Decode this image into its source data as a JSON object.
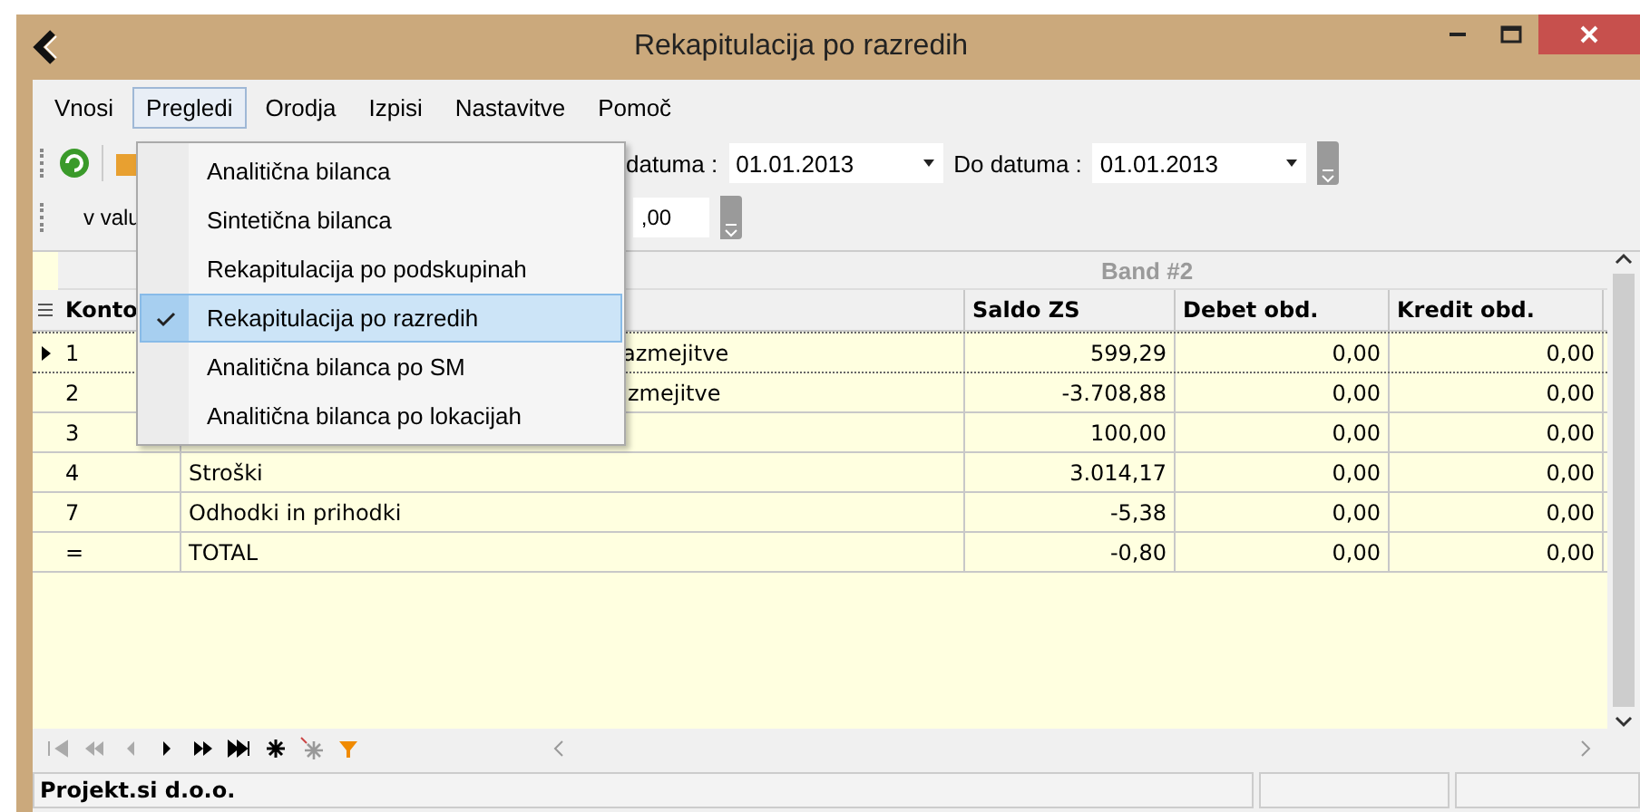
{
  "window": {
    "title": "Rekapitulacija po razredih"
  },
  "menu": [
    {
      "label": "Vnosi",
      "selected": false
    },
    {
      "label": "Pregledi",
      "selected": true
    },
    {
      "label": "Orodja",
      "selected": false
    },
    {
      "label": "Izpisi",
      "selected": false
    },
    {
      "label": "Nastavitve",
      "selected": false
    },
    {
      "label": "Pomoč",
      "selected": false
    }
  ],
  "dropdown": [
    {
      "label": "Analitična bilanca",
      "checked": false,
      "selected": false
    },
    {
      "label": "Sintetična bilanca",
      "checked": false,
      "selected": false
    },
    {
      "label": "Rekapitulacija po podskupinah",
      "checked": false,
      "selected": false
    },
    {
      "label": "Rekapitulacija po razredih",
      "checked": true,
      "selected": true
    },
    {
      "label": "Analitična bilanca po SM",
      "checked": false,
      "selected": false
    },
    {
      "label": "Analitična bilanca po lokacijah",
      "checked": false,
      "selected": false
    }
  ],
  "toolbar": {
    "from_label": "datuma :",
    "from_date": "01.01.2013",
    "to_label": "Do datuma :",
    "to_date": "01.01.2013"
  },
  "toolbar2": {
    "currency_label": "v valu",
    "amount": ",00"
  },
  "grid": {
    "band": "Band #2",
    "columns": [
      {
        "label": "Konto"
      },
      {},
      {
        "label": "Saldo ZS"
      },
      {
        "label": "Debet obd."
      },
      {
        "label": "Kredit obd."
      }
    ],
    "rows": [
      {
        "konto": "1",
        "description": "azmejitve",
        "partly_hidden": true,
        "saldo": "599,29",
        "debet": "0,00",
        "kredit": "0,00",
        "selected": true
      },
      {
        "konto": "2",
        "description": "zmejitve",
        "partly_hidden": true,
        "saldo": "-3.708,88",
        "debet": "0,00",
        "kredit": "0,00",
        "selected": false
      },
      {
        "konto": "3",
        "saldo": "100,00",
        "debet": "0,00",
        "kredit": "0,00",
        "selected": false
      },
      {
        "konto": "4",
        "description": "Stroški",
        "partly_hidden": false,
        "saldo": "3.014,17",
        "debet": "0,00",
        "kredit": "0,00",
        "selected": false
      },
      {
        "konto": "7",
        "description": "Odhodki in prihodki",
        "partly_hidden": false,
        "saldo": "-5,38",
        "debet": "0,00",
        "kredit": "0,00",
        "selected": false
      },
      {
        "konto": "=",
        "description": "TOTAL",
        "partly_hidden": false,
        "saldo": "-0,80",
        "debet": "0,00",
        "kredit": "0,00",
        "selected": false
      }
    ]
  },
  "status_bar": [
    "Projekt.si d.o.o."
  ]
}
